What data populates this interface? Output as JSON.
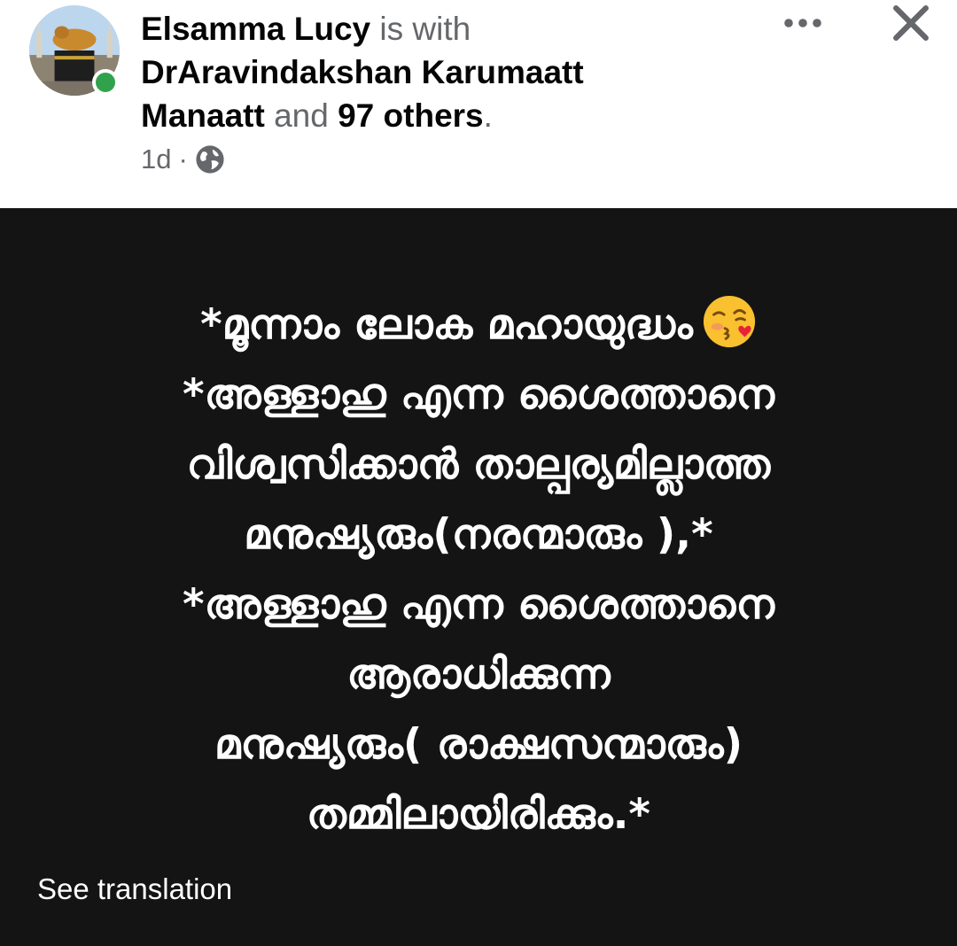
{
  "header": {
    "author": "Elsamma Lucy",
    "is_with": "is with",
    "tagged_person": "DrAravindakshan Karumaatt Manaatt",
    "and": "and",
    "others": "97 others",
    "period": ".",
    "time": "1d",
    "separator": "·",
    "audience_icon": "globe-icon",
    "more_icon": "more-horizontal-icon",
    "close_icon": "close-icon",
    "online_color": "#31a24c"
  },
  "post": {
    "background_color": "#141414",
    "lines": [
      "*മൂന്നാം ലോക മഹായുദ്ധം",
      "*അള്ളാഹു എന്ന ശൈത്താനെ",
      "വിശ്വസിക്കാൻ താല്പര്യമില്ലാത്ത",
      "മനുഷ്യരും(നരന്മാരും ),*",
      "*അള്ളാഹു എന്ന ശൈത്താനെ",
      "ആരാധിക്കുന്ന",
      "മനുഷ്യരും( രാക്ഷസന്മാരും)",
      "തമ്മിലായിരിക്കും.*"
    ],
    "emoji": "face-blowing-a-kiss",
    "see_translation": "See translation"
  }
}
